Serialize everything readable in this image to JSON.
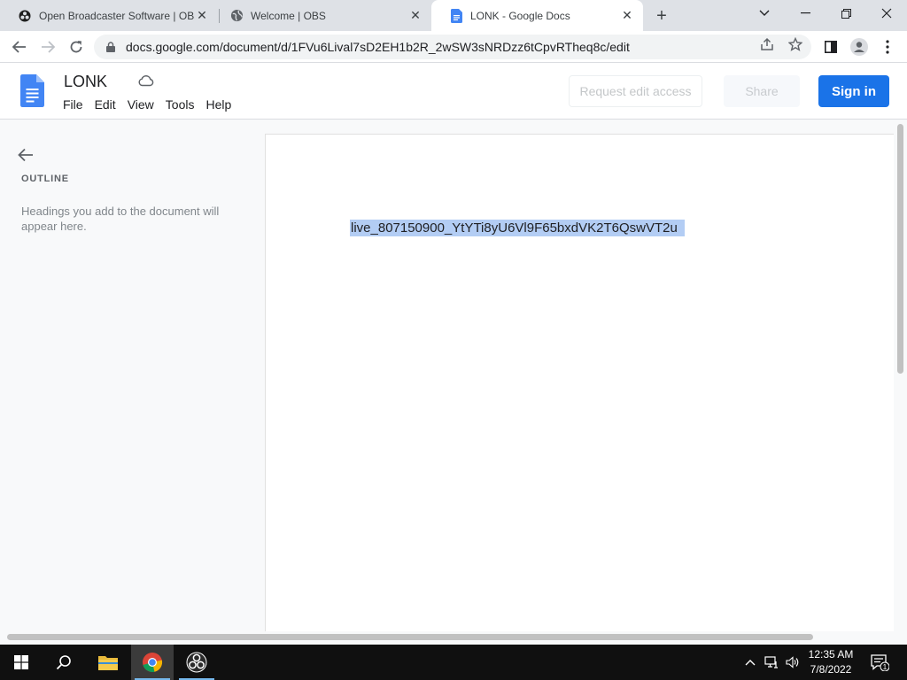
{
  "browser": {
    "tabs": [
      {
        "title": "Open Broadcaster Software | OBS",
        "favicon": "obs-icon"
      },
      {
        "title": "Welcome | OBS",
        "favicon": "globe-icon"
      },
      {
        "title": "LONK - Google Docs",
        "favicon": "google-docs-icon",
        "active": true
      }
    ],
    "new_tab": "+",
    "url": "docs.google.com/document/d/1FVu6Lival7sD2EH1b2R_2wSW3sNRDzz6tCpvRTheq8c/edit"
  },
  "docs": {
    "title": "LONK",
    "menu": [
      "File",
      "Edit",
      "View",
      "Tools",
      "Help"
    ],
    "request_edit_label": "Request edit access",
    "share_label": "Share",
    "sign_in_label": "Sign in",
    "accent_color": "#1a73e8"
  },
  "outline": {
    "label": "OUTLINE",
    "hint": "Headings you add to the document will appear here."
  },
  "document": {
    "selected_text": "live_807150900_YtYTi8yU6Vl9F65bxdVK2T6QswVT2u",
    "selection_color": "#b3cdf4"
  },
  "taskbar": {
    "time": "12:35 AM",
    "date": "7/8/2022",
    "notification_count": "1"
  }
}
